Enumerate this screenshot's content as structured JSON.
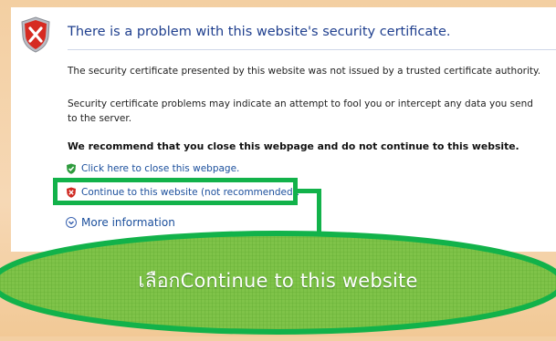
{
  "error_page": {
    "title": "There is a problem with this website's security certificate.",
    "para1": "The security certificate presented by this website was not issued by a trusted certificate authority.",
    "para2": "Security certificate problems may indicate an attempt to fool you or intercept any data you send to the server.",
    "recommend": "We recommend that you close this webpage and do not continue to this website.",
    "close_link": "Click here to close this webpage.",
    "continue_link": "Continue to this website (not recommended).",
    "more_info": "More information"
  },
  "annotation": {
    "callout_text": "เลือกContinue to this website",
    "highlight_color": "#12b24a"
  },
  "icons": {
    "shield": "security-shield-icon",
    "close_shield": "green-shield-icon",
    "continue_shield": "red-shield-icon",
    "more_info": "expand-chevron-icon"
  }
}
